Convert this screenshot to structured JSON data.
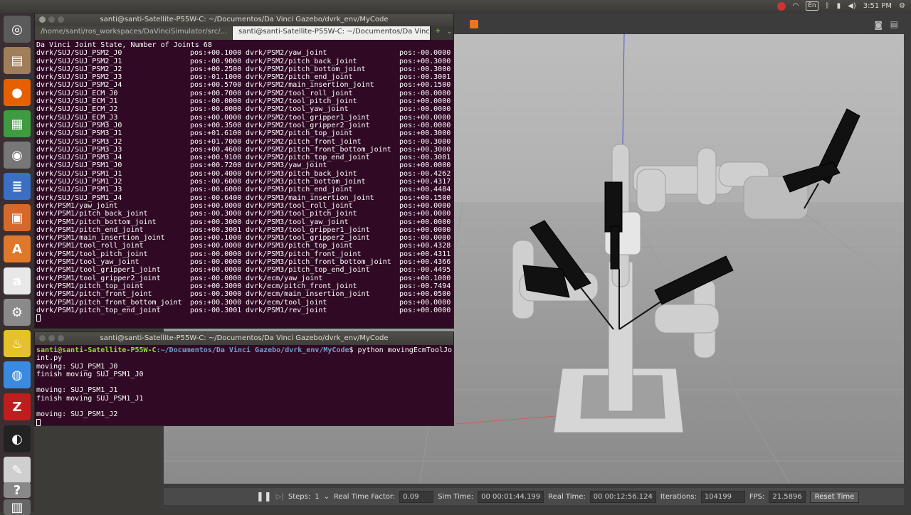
{
  "top_panel": {
    "keyboard_layout": "En",
    "clock": "3:51 PM"
  },
  "launcher": {
    "items": [
      {
        "name": "dash-icon",
        "glyph": "◎",
        "color": "#5b5b5b"
      },
      {
        "name": "files-icon",
        "glyph": "▤",
        "color": "#a07e5a"
      },
      {
        "name": "firefox-icon",
        "glyph": "●",
        "color": "#e66000"
      },
      {
        "name": "spreadsheet-icon",
        "glyph": "▦",
        "color": "#3f9b3f"
      },
      {
        "name": "camera-icon",
        "glyph": "◉",
        "color": "#777777"
      },
      {
        "name": "writer-icon",
        "glyph": "≣",
        "color": "#3a6fc4"
      },
      {
        "name": "impress-icon",
        "glyph": "▣",
        "color": "#d6692a"
      },
      {
        "name": "software-center-icon",
        "glyph": "A",
        "color": "#e0782c"
      },
      {
        "name": "amazon-icon",
        "glyph": "a",
        "color": "#e8e8e8"
      },
      {
        "name": "settings-icon",
        "glyph": "⚙",
        "color": "#8a8a8a"
      },
      {
        "name": "teapot-icon",
        "glyph": "♨",
        "color": "#e5c12a"
      },
      {
        "name": "chrome-icon",
        "glyph": "◍",
        "color": "#3a8ae0"
      },
      {
        "name": "filezilla-icon",
        "glyph": "Z",
        "color": "#bf1e1e"
      },
      {
        "name": "obs-icon",
        "glyph": "◐",
        "color": "#222222"
      },
      {
        "name": "gedit-icon",
        "glyph": "✎",
        "color": "#cfcfcf"
      },
      {
        "name": "help-icon",
        "glyph": "?",
        "color": "#888888"
      },
      {
        "name": "trash-icon",
        "glyph": "▥",
        "color": "#666666"
      }
    ]
  },
  "terminal1": {
    "title": "santi@santi-Satellite-P55W-C: ~/Documentos/Da Vinci Gazebo/dvrk_env/MyCode",
    "tabs": [
      {
        "label": "/home/santi/ros_workspaces/DaVinciSimulator/src/..."
      },
      {
        "label": "santi@santi-Satellite-P55W-C: ~/Documentos/Da Vinc..."
      }
    ],
    "header": "Da Vinci Joint State, Number of Joints 68",
    "rows": [
      [
        "dvrk/SUJ/SUJ_PSM2_J0",
        "pos:+00.1000",
        "dvrk/PSM2/yaw_joint",
        "pos:-00.0000"
      ],
      [
        "dvrk/SUJ/SUJ_PSM2_J1",
        "pos:-00.9000",
        "dvrk/PSM2/pitch_back_joint",
        "pos:+00.3000"
      ],
      [
        "dvrk/SUJ/SUJ_PSM2_J2",
        "pos:+00.2500",
        "dvrk/PSM2/pitch_bottom_joint",
        "pos:-00.3000"
      ],
      [
        "dvrk/SUJ/SUJ_PSM2_J3",
        "pos:-01.1000",
        "dvrk/PSM2/pitch_end_joint",
        "pos:-00.3001"
      ],
      [
        "dvrk/SUJ/SUJ_PSM2_J4",
        "pos:+00.5700",
        "dvrk/PSM2/main_insertion_joint",
        "pos:+00.1500"
      ],
      [
        "dvrk/SUJ/SUJ_ECM_J0",
        "pos:+00.7000",
        "dvrk/PSM2/tool_roll_joint",
        "pos:-00.0000"
      ],
      [
        "dvrk/SUJ/SUJ_ECM_J1",
        "pos:-00.0000",
        "dvrk/PSM2/tool_pitch_joint",
        "pos:+00.0000"
      ],
      [
        "dvrk/SUJ/SUJ_ECM_J2",
        "pos:-00.0000",
        "dvrk/PSM2/tool_yaw_joint",
        "pos:-00.0000"
      ],
      [
        "dvrk/SUJ/SUJ_ECM_J3",
        "pos:+00.0000",
        "dvrk/PSM2/tool_gripper1_joint",
        "pos:+00.0000"
      ],
      [
        "dvrk/SUJ/SUJ_PSM3_J0",
        "pos:+00.3500",
        "dvrk/PSM2/tool_gripper2_joint",
        "pos:-00.0000"
      ],
      [
        "dvrk/SUJ/SUJ_PSM3_J1",
        "pos:+01.6100",
        "dvrk/PSM2/pitch_top_joint",
        "pos:+00.3000"
      ],
      [
        "dvrk/SUJ/SUJ_PSM3_J2",
        "pos:+01.7000",
        "dvrk/PSM2/pitch_front_joint",
        "pos:-00.3000"
      ],
      [
        "dvrk/SUJ/SUJ_PSM3_J3",
        "pos:+00.4600",
        "dvrk/PSM2/pitch_front_bottom_joint",
        "pos:+00.3000"
      ],
      [
        "dvrk/SUJ/SUJ_PSM3_J4",
        "pos:+00.9100",
        "dvrk/PSM2/pitch_top_end_joint",
        "pos:-00.3001"
      ],
      [
        "dvrk/SUJ/SUJ_PSM1_J0",
        "pos:+00.7200",
        "dvrk/PSM3/yaw_joint",
        "pos:+00.0000"
      ],
      [
        "dvrk/SUJ/SUJ_PSM1_J1",
        "pos:+00.4000",
        "dvrk/PSM3/pitch_back_joint",
        "pos:-00.4262"
      ],
      [
        "dvrk/SUJ/SUJ_PSM1_J2",
        "pos:-00.6000",
        "dvrk/PSM3/pitch_bottom_joint",
        "pos:+00.4317"
      ],
      [
        "dvrk/SUJ/SUJ_PSM1_J3",
        "pos:-00.6000",
        "dvrk/PSM3/pitch_end_joint",
        "pos:+00.4484"
      ],
      [
        "dvrk/SUJ/SUJ_PSM1_J4",
        "pos:-00.6400",
        "dvrk/PSM3/main_insertion_joint",
        "pos:+00.1500"
      ],
      [
        "dvrk/PSM1/yaw_joint",
        "pos:+00.0000",
        "dvrk/PSM3/tool_roll_joint",
        "pos:+00.0000"
      ],
      [
        "dvrk/PSM1/pitch_back_joint",
        "pos:-00.3000",
        "dvrk/PSM3/tool_pitch_joint",
        "pos:+00.0000"
      ],
      [
        "dvrk/PSM1/pitch_bottom_joint",
        "pos:+00.3000",
        "dvrk/PSM3/tool_yaw_joint",
        "pos:+00.0000"
      ],
      [
        "dvrk/PSM1/pitch_end_joint",
        "pos:+00.3001",
        "dvrk/PSM3/tool_gripper1_joint",
        "pos:+00.0000"
      ],
      [
        "dvrk/PSM1/main_insertion_joint",
        "pos:+00.1000",
        "dvrk/PSM3/tool_gripper2_joint",
        "pos:-00.0000"
      ],
      [
        "dvrk/PSM1/tool_roll_joint",
        "pos:+00.0000",
        "dvrk/PSM3/pitch_top_joint",
        "pos:+00.4328"
      ],
      [
        "dvrk/PSM1/tool_pitch_joint",
        "pos:-00.0000",
        "dvrk/PSM3/pitch_front_joint",
        "pos:+00.4311"
      ],
      [
        "dvrk/PSM1/tool_yaw_joint",
        "pos:-00.0000",
        "dvrk/PSM3/pitch_front_bottom_joint",
        "pos:+00.4366"
      ],
      [
        "dvrk/PSM1/tool_gripper1_joint",
        "pos:+00.0000",
        "dvrk/PSM3/pitch_top_end_joint",
        "pos:-00.4495"
      ],
      [
        "dvrk/PSM1/tool_gripper2_joint",
        "pos:-00.0000",
        "dvrk/ecm/yaw_joint",
        "pos:+00.1000"
      ],
      [
        "dvrk/PSM1/pitch_top_joint",
        "pos:+00.3000",
        "dvrk/ecm/pitch_front_joint",
        "pos:-00.7494"
      ],
      [
        "dvrk/PSM1/pitch_front_joint",
        "pos:-00.3000",
        "dvrk/ecm/main_insertion_joint",
        "pos:+00.0500"
      ],
      [
        "dvrk/PSM1/pitch_front_bottom_joint",
        "pos:+00.3000",
        "dvrk/ecm/tool_joint",
        "pos:+00.0000"
      ],
      [
        "dvrk/PSM1/pitch_top_end_joint",
        "pos:-00.3001",
        "dvrk/PSM1/rev_joint",
        "pos:+00.0000"
      ]
    ]
  },
  "terminal2": {
    "title": "santi@santi-Satellite-P55W-C: ~/Documentos/Da Vinci Gazebo/dvrk_env/MyCode",
    "prompt_user": "santi@santi-Satellite-P55W-C",
    "prompt_path": ":~/Documentos/Da Vinci Gazebo/dvrk_env/MyCode",
    "command": "$ python movingEcmToolJo",
    "command_wrap": "int.py",
    "output": [
      "moving: SUJ_PSM1_J0",
      "finish moving SUJ_PSM1_J0",
      "",
      "moving: SUJ_PSM1_J1",
      "finish moving SUJ_PSM1_J1",
      "",
      "moving: SUJ_PSM1_J2"
    ]
  },
  "gazebo": {
    "steps_label": "Steps:",
    "steps_value": "1",
    "rtf_label": "Real Time Factor:",
    "rtf_value": "0.09",
    "sim_time_label": "Sim Time:",
    "sim_time_value": "00 00:01:44.199",
    "real_time_label": "Real Time:",
    "real_time_value": "00 00:12:56.124",
    "iterations_label": "Iterations:",
    "iterations_value": "104199",
    "fps_label": "FPS:",
    "fps_value": "21.5896",
    "reset_label": "Reset Time"
  }
}
